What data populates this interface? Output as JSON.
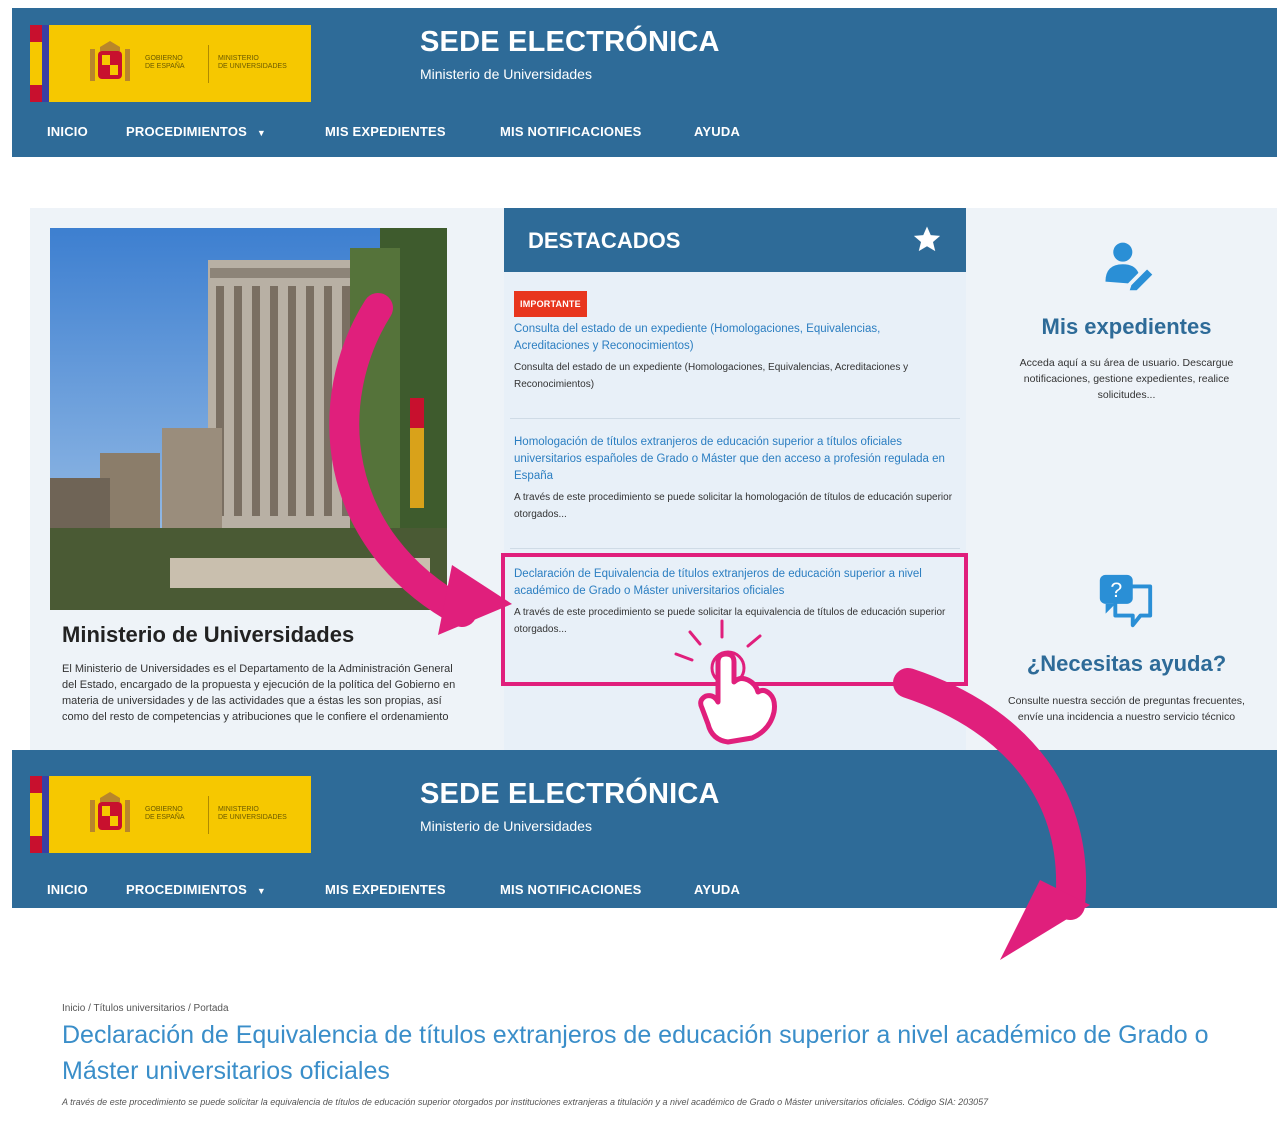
{
  "header": {
    "title": "SEDE ELECTRÓNICA",
    "subtitle": "Ministerio de Universidades",
    "logo_left_text": "GOBIERNO\nDE ESPAÑA",
    "logo_right_text": "MINISTERIO\nDE UNIVERSIDADES"
  },
  "nav": {
    "items": [
      "INICIO",
      "PROCEDIMIENTOS",
      "MIS EXPEDIENTES",
      "MIS NOTIFICACIONES",
      "AYUDA"
    ],
    "dropdown_indicator": "▼"
  },
  "ministerio": {
    "title": "Ministerio de Universidades",
    "description": "El Ministerio de Universidades es el Departamento de la Administración General del Estado, encargado de la propuesta y ejecución de la política del Gobierno en materia de universidades y de las actividades que a éstas les son propias, así como del resto de competencias y atribuciones que le confiere el ordenamiento"
  },
  "destacados": {
    "title": "DESTACADOS",
    "items": [
      {
        "badge": "IMPORTANTE",
        "link": "Consulta del estado de un expediente (Homologaciones, Equivalencias, Acreditaciones y Reconocimientos)",
        "desc": "Consulta del estado de un expediente (Homologaciones, Equivalencias, Acreditaciones y Reconocimientos)"
      },
      {
        "badge": "",
        "link": "Homologación de títulos extranjeros de educación superior a títulos oficiales universitarios españoles de Grado o Máster que den acceso a profesión regulada en España",
        "desc": "A través de este procedimiento se puede solicitar la homologación de títulos de educación superior otorgados..."
      },
      {
        "badge": "",
        "link": "Declaración de Equivalencia de títulos extranjeros de educación superior a nivel académico de Grado o Máster universitarios oficiales",
        "desc": "A través de este procedimiento se puede solicitar la equivalencia de títulos de educación superior otorgados..."
      }
    ]
  },
  "side_cards": {
    "expedientes": {
      "title": "Mis expedientes",
      "desc": "Acceda aquí a su área de usuario. Descargue notificaciones, gestione expedientes, realice solicitudes..."
    },
    "ayuda": {
      "title": "¿Necesitas ayuda?",
      "desc": "Consulte nuestra sección de preguntas frecuentes, envíe una incidencia a nuestro servicio técnico"
    }
  },
  "detail": {
    "breadcrumb": "Inicio / Títulos universitarios / Portada",
    "title": "Declaración de Equivalencia de títulos extranjeros de educación superior a nivel académico de Grado o Máster universitarios oficiales",
    "description": "A través de este procedimiento se puede solicitar la equivalencia de títulos de educación superior otorgados por instituciones extranjeras a titulación y a nivel académico de Grado o Máster universitarios oficiales. Código SIA: 203057"
  },
  "colors": {
    "brand_blue": "#2e6b98",
    "link_blue": "#2b7ec1",
    "accent_pink": "#e01f7c",
    "badge_red": "#e8361e",
    "logo_yellow": "#f6c800"
  }
}
